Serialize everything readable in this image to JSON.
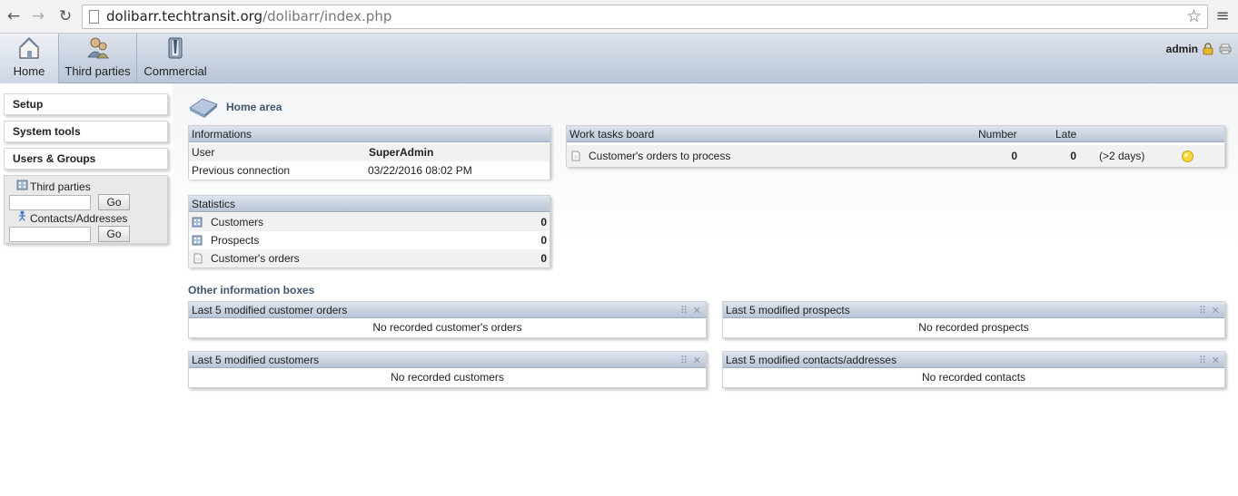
{
  "browser": {
    "url_host": "dolibarr.techtransit.org",
    "url_path": "/dolibarr/index.php",
    "back_icon": "back-arrow-icon",
    "forward_icon": "forward-arrow-icon",
    "reload_icon": "reload-icon",
    "star_icon": "bookmark-star-icon",
    "menu_icon": "hamburger-menu-icon"
  },
  "topmenu": {
    "items": [
      {
        "label": "Home",
        "icon": "home-icon"
      },
      {
        "label": "Third parties",
        "icon": "third-parties-icon"
      },
      {
        "label": "Commercial",
        "icon": "commercial-icon"
      }
    ],
    "login": "admin"
  },
  "leftmenu": {
    "items": [
      {
        "label": "Setup"
      },
      {
        "label": "System tools"
      },
      {
        "label": "Users & Groups"
      }
    ],
    "search": {
      "thirdparties_label": "Third parties",
      "contacts_label": "Contacts/Addresses",
      "go_label": "Go"
    }
  },
  "main": {
    "title": "Home area",
    "informations": {
      "title": "Informations",
      "rows": [
        {
          "label": "User",
          "value": "SuperAdmin"
        },
        {
          "label": "Previous connection",
          "value": "03/22/2016 08:02 PM"
        }
      ]
    },
    "statistics": {
      "title": "Statistics",
      "rows": [
        {
          "label": "Customers",
          "value": "0"
        },
        {
          "label": "Prospects",
          "value": "0"
        },
        {
          "label": "Customer's orders",
          "value": "0"
        }
      ]
    },
    "worktasks": {
      "title": "Work tasks board",
      "col_number": "Number",
      "col_late": "Late",
      "rows": [
        {
          "label": "Customer's orders to process",
          "number": "0",
          "late": "0",
          "delay": "(>2 days)"
        }
      ]
    },
    "other_title": "Other information boxes",
    "boxes": [
      {
        "title": "Last 5 modified customer orders",
        "empty": "No recorded customer's orders"
      },
      {
        "title": "Last 5 modified prospects",
        "empty": "No recorded prospects"
      },
      {
        "title": "Last 5 modified customers",
        "empty": "No recorded customers"
      },
      {
        "title": "Last 5 modified contacts/addresses",
        "empty": "No recorded contacts"
      }
    ]
  }
}
